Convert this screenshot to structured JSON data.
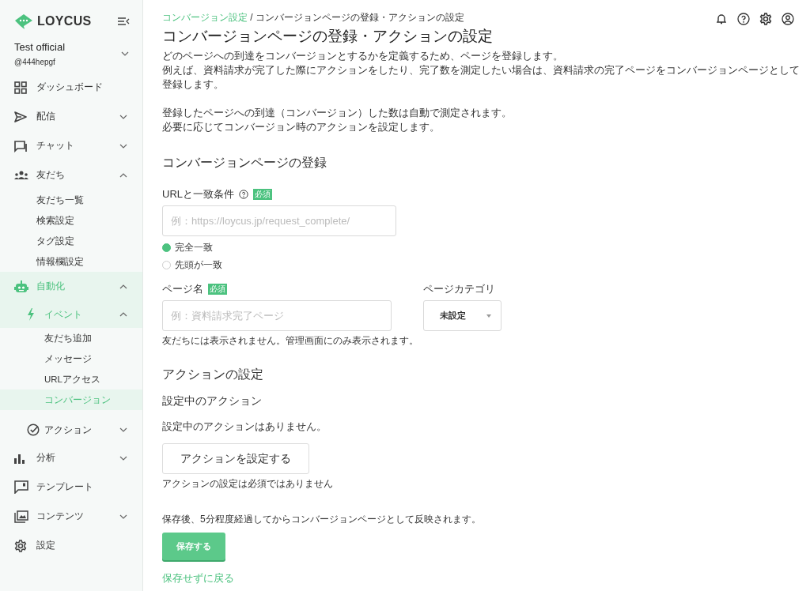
{
  "brand": {
    "name": "LOYCUS"
  },
  "account": {
    "name": "Test official",
    "handle": "@444hepgf",
    "expanded": false
  },
  "nav": [
    {
      "label": "ダッシュボード",
      "selected": false
    },
    {
      "label": "配信",
      "selected": false,
      "expanded": false
    },
    {
      "label": "チャット",
      "selected": false,
      "expanded": false
    },
    {
      "label": "友だち",
      "selected": false,
      "expanded": true,
      "children": [
        {
          "label": "友だち一覧",
          "selected": false
        },
        {
          "label": "検索設定",
          "selected": false
        },
        {
          "label": "タグ設定",
          "selected": false
        },
        {
          "label": "情報欄設定",
          "selected": false
        }
      ]
    },
    {
      "label": "自動化",
      "selected": true,
      "expanded": true,
      "children": [
        {
          "label": "イベント",
          "selected": true,
          "expanded": true,
          "children": [
            {
              "label": "友だち追加",
              "selected": false
            },
            {
              "label": "メッセージ",
              "selected": false
            },
            {
              "label": "URLアクセス",
              "selected": false
            },
            {
              "label": "コンバージョン",
              "selected": true
            }
          ]
        },
        {
          "label": "アクション",
          "selected": false,
          "expanded": false
        }
      ]
    },
    {
      "label": "分析",
      "selected": false,
      "expanded": false
    },
    {
      "label": "テンプレート",
      "selected": false
    },
    {
      "label": "コンテンツ",
      "selected": false,
      "expanded": false
    },
    {
      "label": "設定",
      "selected": false
    }
  ],
  "breadcrumb": {
    "link": "コンバージョン設定",
    "separator": "/",
    "current": "コンバージョンページの登録・アクションの設定"
  },
  "title": "コンバージョンページの登録・アクションの設定",
  "intro": [
    [
      "どのページへの到達をコンバージョンとするかを定義するため、ページを登録します。",
      "例えば、資料請求が完了した際にアクションをしたり、完了数を測定したい場合は、資料請求の完了ページをコンバージョンページとして登録します。"
    ],
    [
      "登録したページへの到達（コンバージョン）した数は自動で測定されます。",
      "必要に応じてコンバージョン時のアクションを設定します。"
    ]
  ],
  "registration": {
    "heading": "コンバージョンページの登録",
    "url_field": {
      "label": "URLと一致条件",
      "required": "必須",
      "placeholder": "例：https://loycus.jp/request_complete/"
    },
    "match_options": [
      {
        "label": "完全一致",
        "selected": true
      },
      {
        "label": "先頭が一致",
        "selected": false
      }
    ],
    "name_field": {
      "label": "ページ名",
      "required": "必須",
      "placeholder": "例：資料請求完了ページ",
      "hint": "友だちには表示されません。管理画面にのみ表示されます。"
    },
    "category": {
      "label": "ページカテゴリ",
      "value": "未設定"
    }
  },
  "actions": {
    "heading": "アクションの設定",
    "subheading": "設定中のアクション",
    "empty": "設定中のアクションはありません。",
    "button": "アクションを設定する",
    "note": "アクションの設定は必須ではありません"
  },
  "footer": {
    "note": "保存後、5分程度経過してからコンバージョンページとして反映されます。",
    "save": "保存する",
    "back": "保存せずに戻る"
  }
}
